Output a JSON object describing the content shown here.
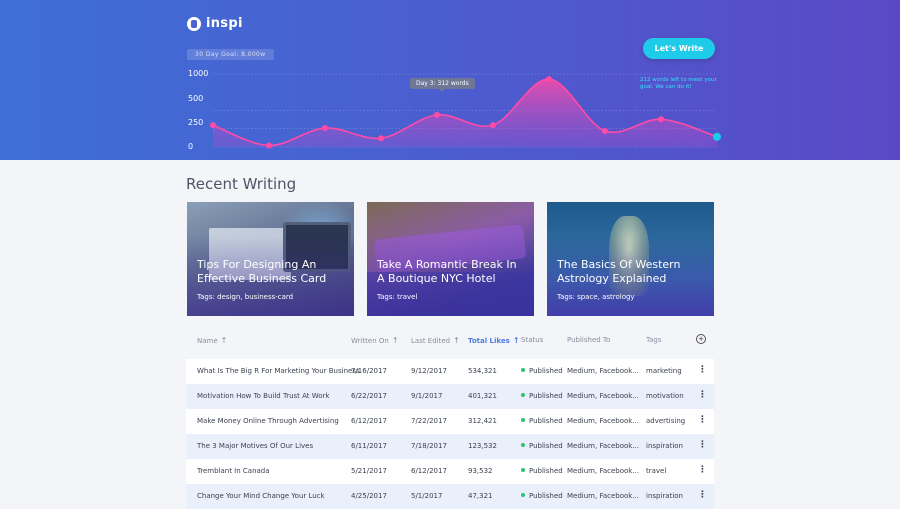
{
  "app": {
    "logo_text": "inspi"
  },
  "hero": {
    "goal_label": "30 Day Goal: 8,000w",
    "cta_label": "Let's Write",
    "tooltip": "Day 3: 312 words",
    "goal_note": "212 words left to meet your goal. We can do it!",
    "colors": {
      "line": "#ff4aa8",
      "accent": "#1ecbe8"
    }
  },
  "chart_data": {
    "type": "area",
    "title": "",
    "xlabel": "",
    "ylabel": "",
    "ylim": [
      0,
      1000
    ],
    "yticks": [
      0,
      250,
      500,
      1000
    ],
    "grid": true,
    "series": [
      {
        "values": [
          300,
          20,
          260,
          120,
          440,
          300,
          930,
          220,
          380,
          140
        ]
      }
    ]
  },
  "section": {
    "title": "Recent Writing"
  },
  "cards": [
    {
      "title": "Tips For Designing An Effective Business Card",
      "tags": "Tags: design, business-card"
    },
    {
      "title": "Take A Romantic Break In A Boutique NYC Hotel",
      "tags": "Tags: travel"
    },
    {
      "title": "The Basics Of Western Astrology Explained",
      "tags": "Tags: space, astrology"
    }
  ],
  "table": {
    "headers": {
      "name": "Name",
      "written_on": "Written On",
      "last_edited": "Last Edited",
      "total_likes": "Total Likes",
      "status": "Status",
      "published_to": "Published To",
      "tags": "Tags"
    },
    "sort_arrow": "↑",
    "add_icon": "+",
    "more_icon": "⋮",
    "rows": [
      {
        "name": "What Is The Big R For Marketing Your Business",
        "written_on": "7/16/2017",
        "last_edited": "9/12/2017",
        "likes": "534,321",
        "status": "Published",
        "published_to": "Medium, Facebook...",
        "tags": "marketing"
      },
      {
        "name": "Motivation How To Build Trust At Work",
        "written_on": "6/22/2017",
        "last_edited": "9/1/2017",
        "likes": "401,321",
        "status": "Published",
        "published_to": "Medium, Facebook...",
        "tags": "motivation"
      },
      {
        "name": "Make Money Online Through Advertising",
        "written_on": "6/12/2017",
        "last_edited": "7/22/2017",
        "likes": "312,421",
        "status": "Published",
        "published_to": "Medium, Facebook...",
        "tags": "advertising"
      },
      {
        "name": "The 3 Major Motives Of Our Lives",
        "written_on": "6/11/2017",
        "last_edited": "7/18/2017",
        "likes": "123,532",
        "status": "Published",
        "published_to": "Medium, Facebook...",
        "tags": "inspiration"
      },
      {
        "name": "Tremblant In Canada",
        "written_on": "5/21/2017",
        "last_edited": "6/12/2017",
        "likes": "93,532",
        "status": "Published",
        "published_to": "Medium, Facebook...",
        "tags": "travel"
      },
      {
        "name": "Change Your Mind Change Your Luck",
        "written_on": "4/25/2017",
        "last_edited": "5/1/2017",
        "likes": "47,321",
        "status": "Published",
        "published_to": "Medium, Facebook...",
        "tags": "inspiration"
      }
    ]
  }
}
